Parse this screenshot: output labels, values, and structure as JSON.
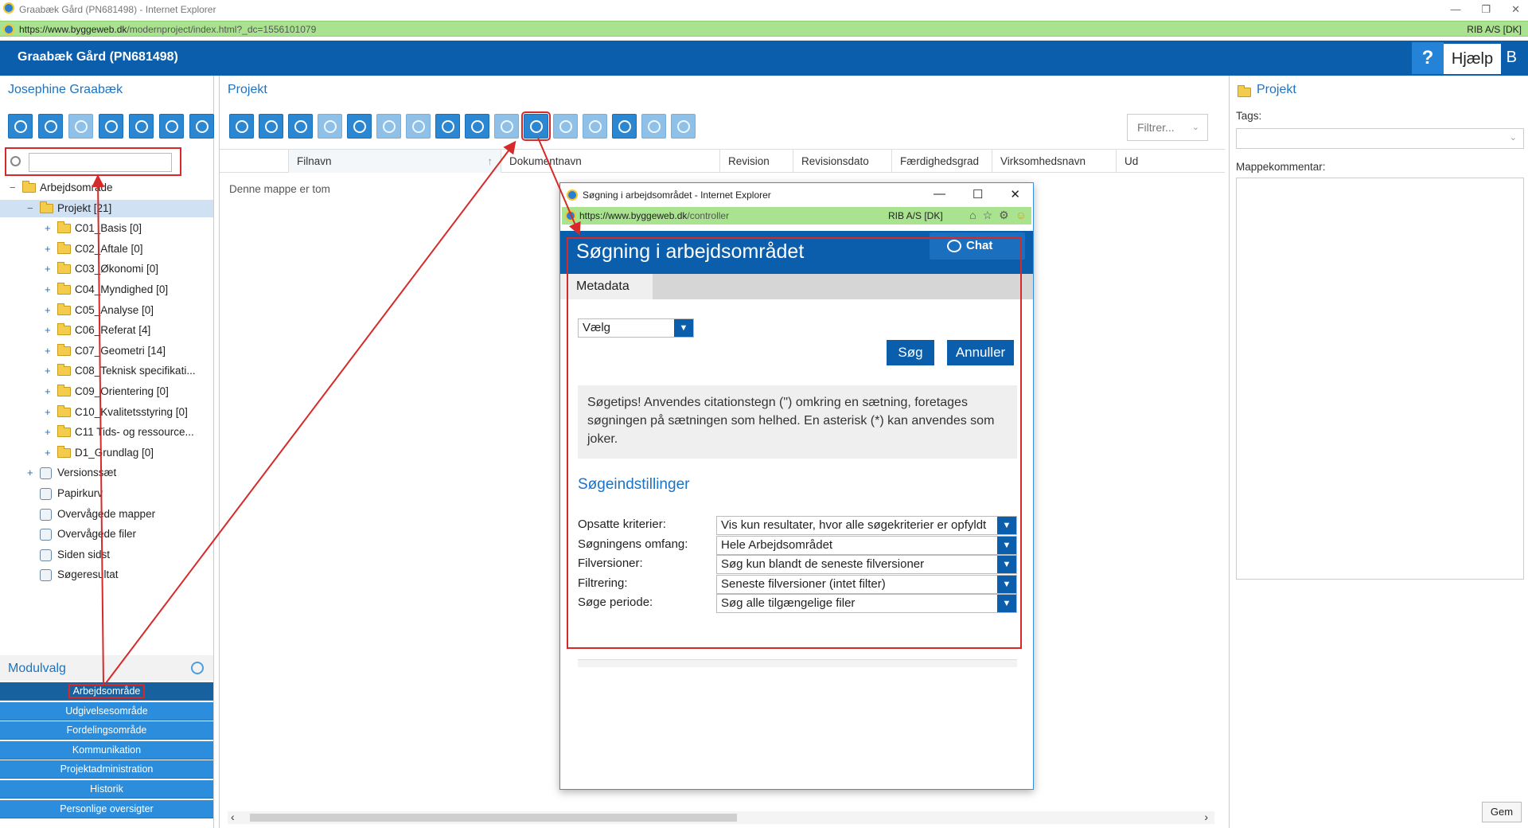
{
  "browser": {
    "window_title": "Graabæk Gård (PN681498) - Internet Explorer",
    "url_host": "https://www.byggeweb.dk",
    "url_path": "/modernproject/index.html?_dc=1556101079",
    "cert_label": "RIB A/S [DK]"
  },
  "header": {
    "title": "Graabæk Gård (PN681498)",
    "help_label": "Hjælp",
    "help_icon": "?",
    "trailing_char": "B"
  },
  "left_pane": {
    "user_name": "Josephine Graabæk",
    "toolbar_icons": [
      "gear-folder-icon",
      "info-folder-icon",
      "folder-icon",
      "delete-folder-icon",
      "view-folder-icon",
      "copy-folder-icon",
      "refresh-folder-icon"
    ],
    "tree": [
      {
        "label": "Arbejdsområde",
        "level": 0,
        "expander": "−",
        "icon": "folder-open"
      },
      {
        "label": "Projekt [21]",
        "level": 1,
        "expander": "−",
        "icon": "folder",
        "selected": true
      },
      {
        "label": "C01_Basis [0]",
        "level": 2,
        "expander": "+",
        "icon": "folder"
      },
      {
        "label": "C02_Aftale [0]",
        "level": 2,
        "expander": "+",
        "icon": "folder"
      },
      {
        "label": "C03_Økonomi [0]",
        "level": 2,
        "expander": "+",
        "icon": "folder"
      },
      {
        "label": "C04_Myndighed [0]",
        "level": 2,
        "expander": "+",
        "icon": "folder"
      },
      {
        "label": "C05_Analyse [0]",
        "level": 2,
        "expander": "+",
        "icon": "folder"
      },
      {
        "label": "C06_Referat [4]",
        "level": 2,
        "expander": "+",
        "icon": "folder"
      },
      {
        "label": "C07_Geometri [14]",
        "level": 2,
        "expander": "+",
        "icon": "folder"
      },
      {
        "label": "C08_Teknisk specifikati...",
        "level": 2,
        "expander": "+",
        "icon": "folder"
      },
      {
        "label": "C09_Orientering [0]",
        "level": 2,
        "expander": "+",
        "icon": "folder"
      },
      {
        "label": "C10_Kvalitetsstyring [0]",
        "level": 2,
        "expander": "+",
        "icon": "folder"
      },
      {
        "label": "C11 Tids- og ressource...",
        "level": 2,
        "expander": "+",
        "icon": "folder"
      },
      {
        "label": "D1_Grundlag [0]",
        "level": 2,
        "expander": "+",
        "icon": "folder"
      },
      {
        "label": "Versionssæt",
        "level": 1,
        "expander": "+",
        "icon": "versions"
      },
      {
        "label": "Papirkurv",
        "level": 1,
        "expander": "",
        "icon": "trash"
      },
      {
        "label": "Overvågede mapper",
        "level": 1,
        "expander": "",
        "icon": "watched-folder"
      },
      {
        "label": "Overvågede filer",
        "level": 1,
        "expander": "",
        "icon": "watched-file"
      },
      {
        "label": "Siden sidst",
        "level": 1,
        "expander": "",
        "icon": "history"
      },
      {
        "label": "Søgeresultat",
        "level": 1,
        "expander": "",
        "icon": "search"
      }
    ],
    "modulvalg_label": "Modulvalg",
    "modules": [
      {
        "label": "Arbejdsområde",
        "active": true
      },
      {
        "label": "Udgivelsesområde"
      },
      {
        "label": "Fordelingsområde"
      },
      {
        "label": "Kommunikation"
      },
      {
        "label": "Projektadministration"
      },
      {
        "label": "Historik"
      },
      {
        "label": "Personlige oversigter"
      }
    ]
  },
  "middle_pane": {
    "heading": "Projekt",
    "filter_label": "Filtrer...",
    "columns": [
      "Filnavn",
      "Dokumentnavn",
      "Revision",
      "Revisionsdato",
      "Færdighedsgrad",
      "Virksomhedsnavn",
      "Ud"
    ],
    "empty_text": "Denne mappe er tom",
    "toolbar_count": 16,
    "highlighted_tool_index": 10
  },
  "right_pane": {
    "heading": "Projekt",
    "tags_label": "Tags:",
    "comment_label": "Mappekommentar:",
    "save_label": "Gem"
  },
  "dialog": {
    "window_title": "Søgning i arbejdsområdet - Internet Explorer",
    "url_host": "https://www.byggeweb.dk",
    "url_path": "/controller",
    "cert_label": "RIB A/S [DK]",
    "title": "Søgning i arbejdsområdet",
    "chat_label": "Chat",
    "tab_label": "Metadata",
    "select_value": "Vælg",
    "search_label": "Søg",
    "cancel_label": "Annuller",
    "tip_text": "Søgetips! Anvendes citationstegn (\") omkring en sætning, foretages søgningen på sætningen som helhed. En asterisk (*) kan anvendes som joker.",
    "section_title": "Søgeindstillinger",
    "settings": [
      {
        "label": "Opsatte kriterier:",
        "value": "Vis kun resultater, hvor alle søgekriterier er opfyldt"
      },
      {
        "label": "Søgningens omfang:",
        "value": "Hele Arbejdsområdet"
      },
      {
        "label": "Filversioner:",
        "value": "Søg kun blandt de seneste filversioner"
      },
      {
        "label": "Filtrering:",
        "value": "Seneste filversioner (intet filter)"
      },
      {
        "label": "Søge periode:",
        "value": "Søg alle tilgængelige filer"
      }
    ]
  },
  "colors": {
    "header_blue": "#0b5eab",
    "accent_blue": "#1d73c3",
    "module_blue": "#2b8ddb",
    "annotation_red": "#d62a2a",
    "address_green": "#a9e38f"
  }
}
